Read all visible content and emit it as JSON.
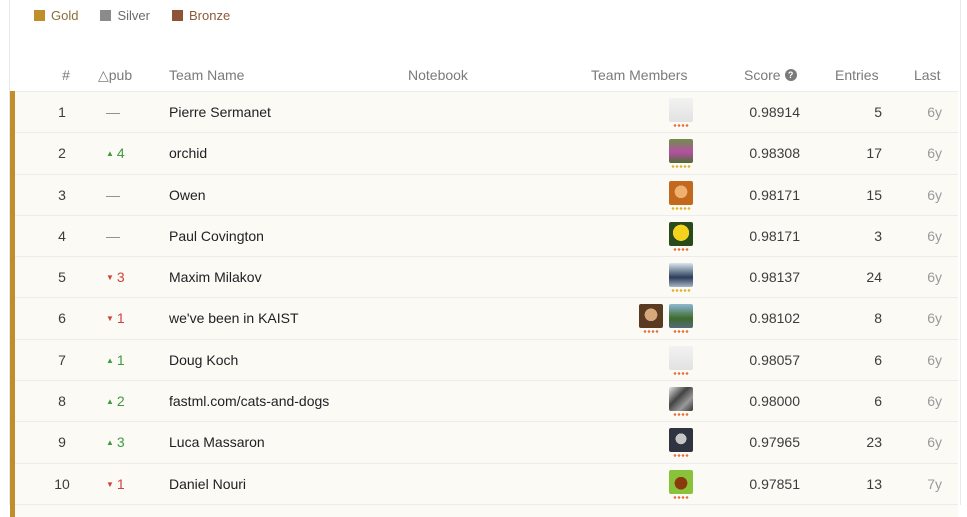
{
  "legend": [
    {
      "label": "Gold",
      "color": "#c08e2a"
    },
    {
      "label": "Silver",
      "color": "#8b8b8b"
    },
    {
      "label": "Bronze",
      "color": "#8d5536"
    }
  ],
  "header": {
    "rank": "#",
    "delta": "△pub",
    "team": "Team Name",
    "notebook": "Notebook",
    "members": "Team Members",
    "score": "Score",
    "entries": "Entries",
    "last": "Last"
  },
  "rows": [
    {
      "rank": "1",
      "delta": "—",
      "dir": "same",
      "team": "Pierre Sermanet",
      "score": "0.98914",
      "entries": "5",
      "last": "6y",
      "avatars": [
        {
          "kind": "ostrich",
          "dots": "#e8703a",
          "n": 4
        }
      ]
    },
    {
      "rank": "2",
      "delta": "4",
      "dir": "up",
      "team": "orchid",
      "score": "0.98308",
      "entries": "17",
      "last": "6y",
      "avatars": [
        {
          "kind": "photo-green",
          "dots": "#e2b32a",
          "n": 5
        }
      ]
    },
    {
      "rank": "3",
      "delta": "—",
      "dir": "same",
      "team": "Owen",
      "score": "0.98171",
      "entries": "15",
      "last": "6y",
      "avatars": [
        {
          "kind": "photo-orange",
          "dots": "#e2b32a",
          "n": 5
        }
      ]
    },
    {
      "rank": "4",
      "delta": "—",
      "dir": "same",
      "team": "Paul Covington",
      "score": "0.98171",
      "entries": "3",
      "last": "6y",
      "avatars": [
        {
          "kind": "bird-yellow",
          "dots": "#e8703a",
          "n": 4
        }
      ]
    },
    {
      "rank": "5",
      "delta": "3",
      "dir": "down",
      "team": "Maxim Milakov",
      "score": "0.98137",
      "entries": "24",
      "last": "6y",
      "avatars": [
        {
          "kind": "photo-blue",
          "dots": "#e2b32a",
          "n": 5
        }
      ]
    },
    {
      "rank": "6",
      "delta": "1",
      "dir": "down",
      "team": "we've been in KAIST",
      "score": "0.98102",
      "entries": "8",
      "last": "6y",
      "avatars": [
        {
          "kind": "photo-face",
          "dots": "#e8703a",
          "n": 4
        },
        {
          "kind": "photo-outdoor",
          "dots": "#e8703a",
          "n": 4
        }
      ]
    },
    {
      "rank": "7",
      "delta": "1",
      "dir": "up",
      "team": "Doug Koch",
      "score": "0.98057",
      "entries": "6",
      "last": "6y",
      "avatars": [
        {
          "kind": "ostrich",
          "dots": "#e8703a",
          "n": 4
        }
      ]
    },
    {
      "rank": "8",
      "delta": "2",
      "dir": "up",
      "team": "fastml.com/cats-and-dogs",
      "score": "0.98000",
      "entries": "6",
      "last": "6y",
      "avatars": [
        {
          "kind": "photo-gray",
          "dots": "#e8703a",
          "n": 4
        }
      ]
    },
    {
      "rank": "9",
      "delta": "3",
      "dir": "up",
      "team": "Luca Massaron",
      "score": "0.97965",
      "entries": "23",
      "last": "6y",
      "avatars": [
        {
          "kind": "photo-dark",
          "dots": "#e8703a",
          "n": 4
        }
      ]
    },
    {
      "rank": "10",
      "delta": "1",
      "dir": "down",
      "team": "Daniel Nouri",
      "score": "0.97851",
      "entries": "13",
      "last": "7y",
      "avatars": [
        {
          "kind": "photo-lime",
          "dots": "#e8703a",
          "n": 4
        }
      ]
    }
  ]
}
